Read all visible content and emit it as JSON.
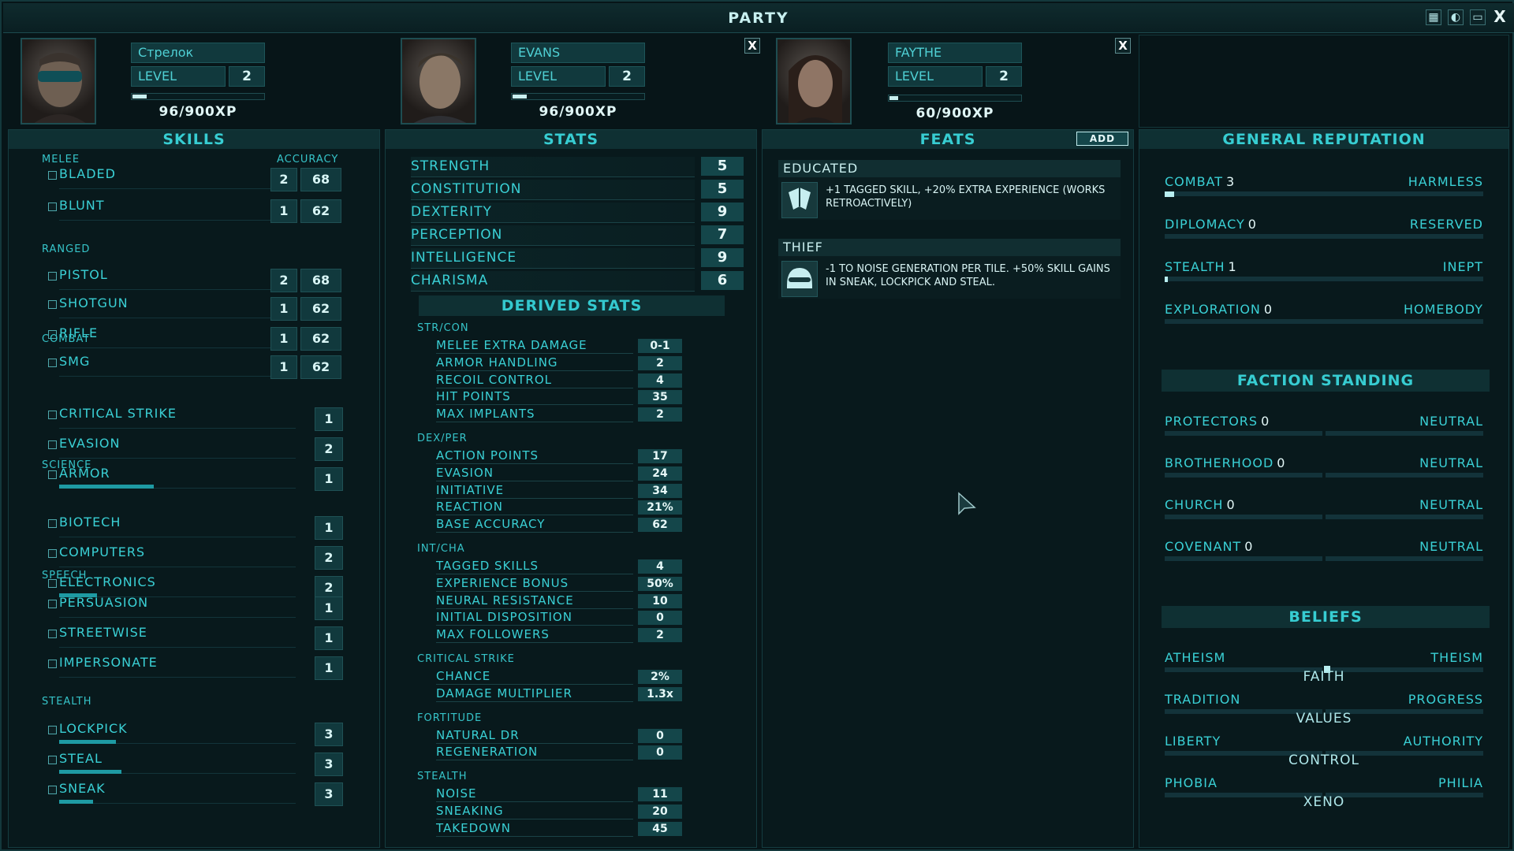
{
  "window": {
    "title": "PARTY"
  },
  "members": [
    {
      "name": "Стрелок",
      "level_label": "LEVEL",
      "level": "2",
      "xp": "96/900XP",
      "xp_fraction": 0.107
    },
    {
      "name": "EVANS",
      "level_label": "LEVEL",
      "level": "2",
      "xp": "96/900XP",
      "xp_fraction": 0.107,
      "close": "X"
    },
    {
      "name": "FAYTHE",
      "level_label": "LEVEL",
      "level": "2",
      "xp": "60/900XP",
      "xp_fraction": 0.067,
      "close": "X"
    }
  ],
  "skills": {
    "title": "SKILLS",
    "accuracy_label": "ACCURACY",
    "groups": [
      {
        "name": "MELEE",
        "items": [
          {
            "label": "BLADED",
            "level": "2",
            "acc": "68"
          },
          {
            "label": "BLUNT",
            "level": "1",
            "acc": "62"
          }
        ]
      },
      {
        "name": "RANGED",
        "items": [
          {
            "label": "PISTOL",
            "level": "2",
            "acc": "68"
          },
          {
            "label": "SHOTGUN",
            "level": "1",
            "acc": "62"
          },
          {
            "label": "RIFLE",
            "level": "1",
            "acc": "62"
          },
          {
            "label": "SMG",
            "level": "1",
            "acc": "62"
          }
        ]
      },
      {
        "name": "COMBAT",
        "items": [
          {
            "label": "CRITICAL STRIKE",
            "level": "1",
            "progress": 0
          },
          {
            "label": "EVASION",
            "level": "2",
            "progress": 0
          },
          {
            "label": "ARMOR",
            "level": "1",
            "progress": 0.5
          }
        ]
      },
      {
        "name": "SCIENCE",
        "items": [
          {
            "label": "BIOTECH",
            "level": "1",
            "progress": 0
          },
          {
            "label": "COMPUTERS",
            "level": "2",
            "progress": 0
          },
          {
            "label": "ELECTRONICS",
            "level": "2",
            "progress": 0.2
          }
        ]
      },
      {
        "name": "SPEECH",
        "items": [
          {
            "label": "PERSUASION",
            "level": "1",
            "progress": 0
          },
          {
            "label": "STREETWISE",
            "level": "1",
            "progress": 0
          },
          {
            "label": "IMPERSONATE",
            "level": "1",
            "progress": 0
          }
        ]
      },
      {
        "name": "STEALTH",
        "items": [
          {
            "label": "LOCKPICK",
            "level": "3",
            "progress": 0.3
          },
          {
            "label": "STEAL",
            "level": "3",
            "progress": 0.33
          },
          {
            "label": "SNEAK",
            "level": "3",
            "progress": 0.18
          }
        ]
      }
    ]
  },
  "stats": {
    "title": "STATS",
    "items": [
      {
        "label": "STRENGTH",
        "value": "5"
      },
      {
        "label": "CONSTITUTION",
        "value": "5"
      },
      {
        "label": "DEXTERITY",
        "value": "9"
      },
      {
        "label": "PERCEPTION",
        "value": "7"
      },
      {
        "label": "INTELLIGENCE",
        "value": "9"
      },
      {
        "label": "CHARISMA",
        "value": "6"
      }
    ],
    "derived_title": "DERIVED STATS",
    "derived": [
      {
        "name": "STR/CON",
        "items": [
          {
            "label": "MELEE EXTRA DAMAGE",
            "value": "0-1"
          },
          {
            "label": "ARMOR HANDLING",
            "value": "2"
          },
          {
            "label": "RECOIL CONTROL",
            "value": "4"
          },
          {
            "label": "HIT POINTS",
            "value": "35"
          },
          {
            "label": "MAX IMPLANTS",
            "value": "2"
          }
        ]
      },
      {
        "name": "DEX/PER",
        "items": [
          {
            "label": "ACTION POINTS",
            "value": "17"
          },
          {
            "label": "EVASION",
            "value": "24"
          },
          {
            "label": "INITIATIVE",
            "value": "34"
          },
          {
            "label": "REACTION",
            "value": "21%"
          },
          {
            "label": "BASE ACCURACY",
            "value": "62"
          }
        ]
      },
      {
        "name": "INT/CHA",
        "items": [
          {
            "label": "TAGGED SKILLS",
            "value": "4"
          },
          {
            "label": "EXPERIENCE BONUS",
            "value": "50%"
          },
          {
            "label": "NEURAL RESISTANCE",
            "value": "10"
          },
          {
            "label": "INITIAL DISPOSITION",
            "value": "0"
          },
          {
            "label": "MAX FOLLOWERS",
            "value": "2"
          }
        ]
      },
      {
        "name": "CRITICAL STRIKE",
        "items": [
          {
            "label": "CHANCE",
            "value": "2%"
          },
          {
            "label": "DAMAGE MULTIPLIER",
            "value": "1.3x"
          }
        ]
      },
      {
        "name": "FORTITUDE",
        "items": [
          {
            "label": "NATURAL DR",
            "value": "0"
          },
          {
            "label": "REGENERATION",
            "value": "0"
          }
        ]
      },
      {
        "name": "STEALTH",
        "items": [
          {
            "label": "NOISE",
            "value": "11"
          },
          {
            "label": "SNEAKING",
            "value": "20"
          },
          {
            "label": "TAKEDOWN",
            "value": "45"
          }
        ]
      }
    ]
  },
  "feats": {
    "title": "FEATS",
    "add_label": "ADD",
    "items": [
      {
        "name": "EDUCATED",
        "desc": "+1 TAGGED SKILL, +20% EXTRA EXPERIENCE (WORKS RETROACTIVELY)",
        "icon": "book-icon"
      },
      {
        "name": "THIEF",
        "desc": "-1 TO NOISE GENERATION PER TILE. +50% SKILL GAINS IN SNEAK, LOCKPICK AND STEAL.",
        "icon": "mask-icon"
      }
    ]
  },
  "reputation": {
    "title": "GENERAL REPUTATION",
    "items": [
      {
        "label": "COMBAT",
        "value": "3",
        "rank": "HARMLESS",
        "fill": 0.03
      },
      {
        "label": "DIPLOMACY",
        "value": "0",
        "rank": "RESERVED",
        "fill": 0
      },
      {
        "label": "STEALTH",
        "value": "1",
        "rank": "INEPT",
        "fill": 0.01
      },
      {
        "label": "EXPLORATION",
        "value": "0",
        "rank": "HOMEBODY",
        "fill": 0
      }
    ]
  },
  "factions": {
    "title": "FACTION STANDING",
    "items": [
      {
        "label": "PROTECTORS",
        "value": "0",
        "rank": "NEUTRAL"
      },
      {
        "label": "BROTHERHOOD",
        "value": "0",
        "rank": "NEUTRAL"
      },
      {
        "label": "CHURCH",
        "value": "0",
        "rank": "NEUTRAL"
      },
      {
        "label": "COVENANT",
        "value": "0",
        "rank": "NEUTRAL"
      }
    ]
  },
  "beliefs": {
    "title": "BELIEFS",
    "items": [
      {
        "left": "ATHEISM",
        "right": "THEISM",
        "caption": "FAITH",
        "position": 0.51
      },
      {
        "left": "TRADITION",
        "right": "PROGRESS",
        "caption": "VALUES",
        "position": null
      },
      {
        "left": "LIBERTY",
        "right": "AUTHORITY",
        "caption": "CONTROL",
        "position": null
      },
      {
        "left": "PHOBIA",
        "right": "PHILIA",
        "caption": "XENO",
        "position": null
      }
    ]
  }
}
